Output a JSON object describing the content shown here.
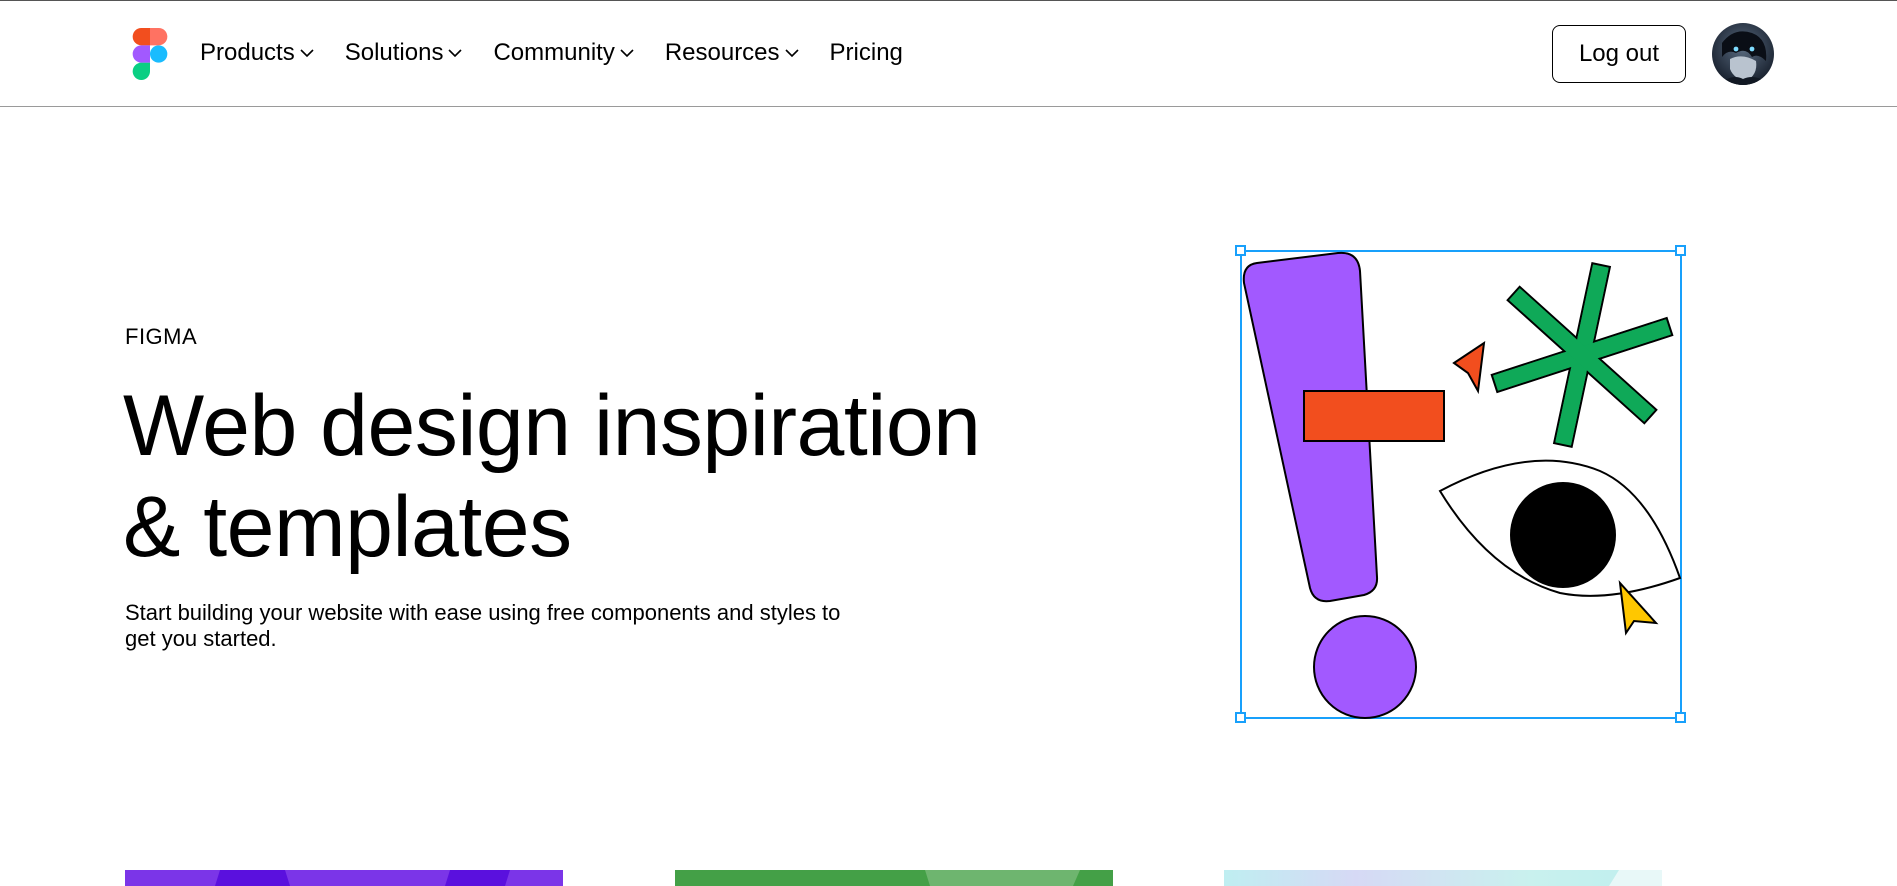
{
  "header": {
    "logo_name": "figma-logo",
    "nav": [
      {
        "label": "Products",
        "has_dropdown": true
      },
      {
        "label": "Solutions",
        "has_dropdown": true
      },
      {
        "label": "Community",
        "has_dropdown": true
      },
      {
        "label": "Resources",
        "has_dropdown": true
      },
      {
        "label": "Pricing",
        "has_dropdown": false
      }
    ],
    "logout_label": "Log out",
    "avatar_icon": "user-avatar"
  },
  "hero": {
    "eyebrow": "FIGMA",
    "title_line1": "Web design inspiration",
    "title_line2": "& templates",
    "subtitle_line1": "Start building your website with ease using free components and styles to",
    "subtitle_line2": "get you started."
  },
  "colors": {
    "selection_blue": "#18a0fb",
    "purple": "#a259ff",
    "orange": "#f24e1e",
    "green": "#0fa958",
    "yellow": "#ffc700",
    "logo_red": "#f24e1e",
    "logo_orange": "#ff7262",
    "logo_purple": "#a259ff",
    "logo_blue": "#1abcfe",
    "logo_green": "#0acf83"
  }
}
